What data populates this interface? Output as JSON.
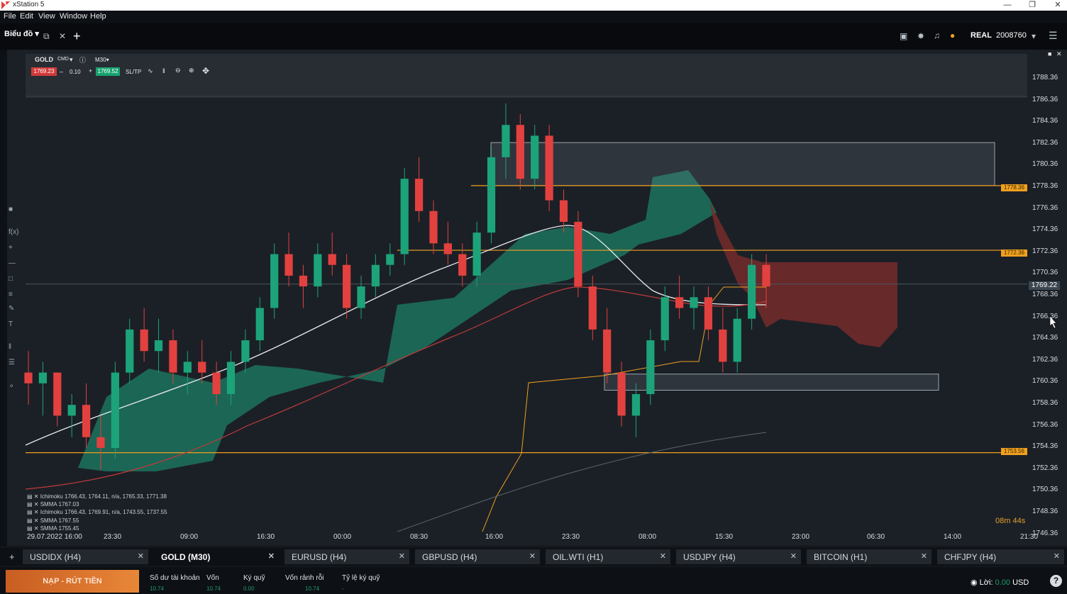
{
  "window": {
    "title": "xStation 5"
  },
  "menu": [
    "File",
    "Edit",
    "View",
    "Window",
    "Help"
  ],
  "topbar": {
    "tab_label": "Biểu đồ",
    "account_type": "REAL",
    "account_number": "2008760"
  },
  "toolbar": {
    "symbol": "GOLD",
    "cmd_label": "CMD",
    "timeframe": "M30",
    "sell_price": "1769.23",
    "volume": "0.10",
    "buy_price": "1769.52",
    "sltp_label": "SL/TP"
  },
  "y_axis": [
    "1788.36",
    "1786.36",
    "1784.36",
    "1782.36",
    "1780.36",
    "1778.36",
    "1776.36",
    "1774.36",
    "1772.36",
    "1770.36",
    "1768.36",
    "1766.36",
    "1764.36",
    "1762.36",
    "1760.36",
    "1758.36",
    "1756.36",
    "1754.36",
    "1752.36",
    "1750.36",
    "1748.36",
    "1746.36"
  ],
  "x_axis": [
    "29.07.2022 16:00",
    "23:30",
    "09:00",
    "16:30",
    "00:00",
    "08:30",
    "16:00",
    "23:30",
    "08:00",
    "15:30",
    "23:00",
    "06:30",
    "14:00",
    "21:30"
  ],
  "level_tags": [
    "1778.36",
    "1772.36",
    "1753.56"
  ],
  "current_price": "1769.22",
  "legend": [
    "Ichimoku 1766.43, 1764.11, n/a, 1765.33, 1771.38",
    "SMMA 1767.03",
    "Ichimoku 1766.43, 1769.91, n/a, 1743.55, 1737.55",
    "SMMA 1767.55",
    "SMMA 1755.45"
  ],
  "countdown": "08m 44s",
  "instrument_tabs": [
    {
      "label": "USDIDX (H4)",
      "active": false
    },
    {
      "label": "GOLD (M30)",
      "active": true
    },
    {
      "label": "EURUSD (H4)",
      "active": false
    },
    {
      "label": "GBPUSD (H4)",
      "active": false
    },
    {
      "label": "OIL.WTI (H1)",
      "active": false
    },
    {
      "label": "USDJPY (H4)",
      "active": false
    },
    {
      "label": "BITCOIN (H1)",
      "active": false
    },
    {
      "label": "CHFJPY (H4)",
      "active": false
    }
  ],
  "account": {
    "deposit_button": "NẠP - RÚT TIỀN",
    "fields": [
      {
        "label": "Số dư tài khoản",
        "value": "10.74"
      },
      {
        "label": "Vốn",
        "value": "10.74"
      },
      {
        "label": "Ký quỹ",
        "value": "0.00"
      },
      {
        "label": "Vốn rảnh rỗi",
        "value": "10.74"
      },
      {
        "label": "Tỷ lệ ký quỹ",
        "value": "-"
      }
    ],
    "profit_label": "Lời:",
    "profit_value": "0.00",
    "currency": "USD"
  },
  "colors": {
    "bull": "#1ca37a",
    "bear": "#e2413f",
    "level": "#f0a020",
    "cloud_green": "#1d7e66",
    "cloud_red": "#7c2c2c"
  },
  "chart_data": {
    "type": "candlestick",
    "symbol": "GOLD",
    "timeframe": "M30",
    "ylim": [
      1746.36,
      1788.36
    ],
    "horizontal_levels": [
      1778.36,
      1772.36,
      1753.56
    ],
    "current_price": 1769.22,
    "zones": [
      {
        "from": 1778.36,
        "to": 1782.36
      },
      {
        "from": 1759.36,
        "to": 1760.86
      }
    ],
    "candles_ohlc": [
      [
        1761,
        1763,
        1758,
        1760
      ],
      [
        1760,
        1762,
        1757,
        1761
      ],
      [
        1761,
        1761,
        1756,
        1757
      ],
      [
        1757,
        1759,
        1755,
        1758
      ],
      [
        1758,
        1760,
        1754,
        1755
      ],
      [
        1755,
        1757,
        1752,
        1754
      ],
      [
        1754,
        1762,
        1753,
        1761
      ],
      [
        1761,
        1766,
        1760,
        1765
      ],
      [
        1765,
        1767,
        1762,
        1763
      ],
      [
        1763,
        1766,
        1761,
        1764
      ],
      [
        1764,
        1765,
        1760,
        1761
      ],
      [
        1761,
        1763,
        1759,
        1762
      ],
      [
        1762,
        1764,
        1760,
        1761
      ],
      [
        1761,
        1762,
        1758,
        1759
      ],
      [
        1759,
        1763,
        1758,
        1762
      ],
      [
        1762,
        1765,
        1761,
        1764
      ],
      [
        1764,
        1768,
        1763,
        1767
      ],
      [
        1767,
        1773,
        1766,
        1772
      ],
      [
        1772,
        1774,
        1769,
        1770
      ],
      [
        1770,
        1771,
        1767,
        1769
      ],
      [
        1769,
        1773,
        1768,
        1772
      ],
      [
        1772,
        1774,
        1770,
        1771
      ],
      [
        1771,
        1772,
        1766,
        1767
      ],
      [
        1767,
        1770,
        1766,
        1769
      ],
      [
        1769,
        1772,
        1768,
        1771
      ],
      [
        1771,
        1773,
        1770,
        1772
      ],
      [
        1772,
        1780,
        1771,
        1779
      ],
      [
        1779,
        1781,
        1775,
        1776
      ],
      [
        1776,
        1777,
        1772,
        1773
      ],
      [
        1773,
        1775,
        1771,
        1772
      ],
      [
        1772,
        1773,
        1769,
        1770
      ],
      [
        1770,
        1775,
        1769,
        1774
      ],
      [
        1774,
        1782,
        1773,
        1781
      ],
      [
        1781,
        1786,
        1779,
        1784
      ],
      [
        1784,
        1785,
        1778,
        1779
      ],
      [
        1779,
        1784,
        1778,
        1783
      ],
      [
        1783,
        1784,
        1776,
        1777
      ],
      [
        1777,
        1778,
        1774,
        1775
      ],
      [
        1775,
        1776,
        1768,
        1769
      ],
      [
        1769,
        1770,
        1764,
        1765
      ],
      [
        1765,
        1767,
        1760,
        1761
      ],
      [
        1761,
        1762,
        1756,
        1757
      ],
      [
        1757,
        1760,
        1755,
        1759
      ],
      [
        1759,
        1765,
        1758,
        1764
      ],
      [
        1764,
        1769,
        1763,
        1768
      ],
      [
        1768,
        1770,
        1766,
        1767
      ],
      [
        1767,
        1769,
        1765,
        1768
      ],
      [
        1768,
        1769,
        1764,
        1765
      ],
      [
        1765,
        1767,
        1761,
        1762
      ],
      [
        1762,
        1767,
        1761,
        1766
      ],
      [
        1766,
        1772,
        1765,
        1771
      ],
      [
        1771,
        1772,
        1767,
        1769
      ]
    ]
  }
}
